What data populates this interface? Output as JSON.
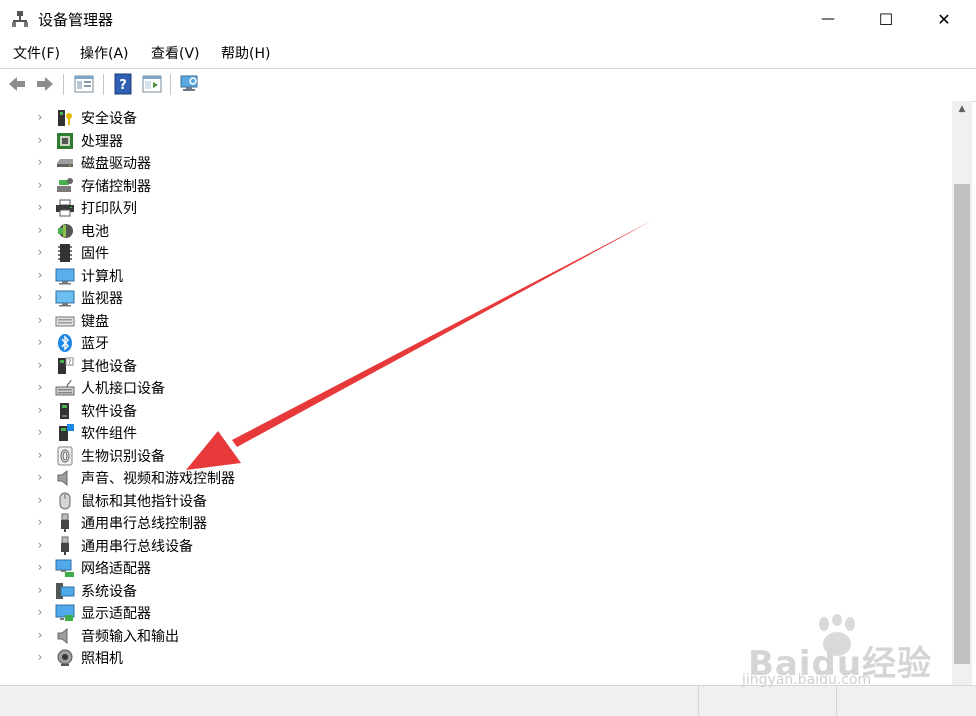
{
  "window": {
    "title": "设备管理器",
    "controls": {
      "minimize": "—",
      "maximize": "☐",
      "close": "✕"
    }
  },
  "menu": [
    {
      "label": "文件(F)"
    },
    {
      "label": "操作(A)"
    },
    {
      "label": "查看(V)"
    },
    {
      "label": "帮助(H)"
    }
  ],
  "toolbar": [
    {
      "icon": "back-arrow-icon"
    },
    {
      "icon": "forward-arrow-icon"
    },
    {
      "icon": "properties-icon"
    },
    {
      "icon": "help-icon"
    },
    {
      "icon": "details-view-icon"
    },
    {
      "icon": "scan-hardware-icon"
    }
  ],
  "tree": {
    "items": [
      {
        "label": "安全设备",
        "icon": "security-device-icon"
      },
      {
        "label": "处理器",
        "icon": "processor-icon"
      },
      {
        "label": "磁盘驱动器",
        "icon": "disk-drive-icon"
      },
      {
        "label": "存储控制器",
        "icon": "storage-controller-icon"
      },
      {
        "label": "打印队列",
        "icon": "printer-icon"
      },
      {
        "label": "电池",
        "icon": "battery-icon"
      },
      {
        "label": "固件",
        "icon": "firmware-icon"
      },
      {
        "label": "计算机",
        "icon": "computer-icon"
      },
      {
        "label": "监视器",
        "icon": "monitor-icon"
      },
      {
        "label": "键盘",
        "icon": "keyboard-icon"
      },
      {
        "label": "蓝牙",
        "icon": "bluetooth-icon"
      },
      {
        "label": "其他设备",
        "icon": "other-device-icon"
      },
      {
        "label": "人机接口设备",
        "icon": "hid-icon"
      },
      {
        "label": "软件设备",
        "icon": "software-device-icon"
      },
      {
        "label": "软件组件",
        "icon": "software-component-icon"
      },
      {
        "label": "生物识别设备",
        "icon": "fingerprint-icon"
      },
      {
        "label": "声音、视频和游戏控制器",
        "icon": "speaker-icon"
      },
      {
        "label": "鼠标和其他指针设备",
        "icon": "mouse-icon"
      },
      {
        "label": "通用串行总线控制器",
        "icon": "usb-controller-icon"
      },
      {
        "label": "通用串行总线设备",
        "icon": "usb-device-icon"
      },
      {
        "label": "网络适配器",
        "icon": "network-adapter-icon"
      },
      {
        "label": "系统设备",
        "icon": "system-device-icon"
      },
      {
        "label": "显示适配器",
        "icon": "display-adapter-icon"
      },
      {
        "label": "音频输入和输出",
        "icon": "audio-io-icon"
      },
      {
        "label": "照相机",
        "icon": "camera-icon"
      }
    ]
  },
  "annotation": {
    "target": "声音、视频和游戏控制器",
    "color": "#e8393a"
  },
  "watermark": {
    "logo": "Baidu经验",
    "url": "jingyan.baidu.com"
  }
}
